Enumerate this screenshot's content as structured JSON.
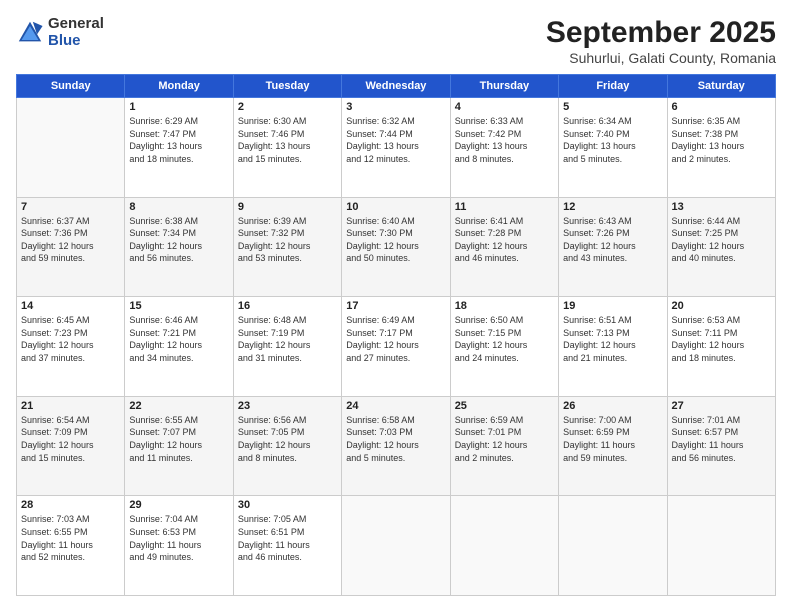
{
  "logo": {
    "general": "General",
    "blue": "Blue"
  },
  "title": "September 2025",
  "subtitle": "Suhurlui, Galati County, Romania",
  "days_header": [
    "Sunday",
    "Monday",
    "Tuesday",
    "Wednesday",
    "Thursday",
    "Friday",
    "Saturday"
  ],
  "weeks": [
    [
      {
        "num": "",
        "info": ""
      },
      {
        "num": "1",
        "info": "Sunrise: 6:29 AM\nSunset: 7:47 PM\nDaylight: 13 hours\nand 18 minutes."
      },
      {
        "num": "2",
        "info": "Sunrise: 6:30 AM\nSunset: 7:46 PM\nDaylight: 13 hours\nand 15 minutes."
      },
      {
        "num": "3",
        "info": "Sunrise: 6:32 AM\nSunset: 7:44 PM\nDaylight: 13 hours\nand 12 minutes."
      },
      {
        "num": "4",
        "info": "Sunrise: 6:33 AM\nSunset: 7:42 PM\nDaylight: 13 hours\nand 8 minutes."
      },
      {
        "num": "5",
        "info": "Sunrise: 6:34 AM\nSunset: 7:40 PM\nDaylight: 13 hours\nand 5 minutes."
      },
      {
        "num": "6",
        "info": "Sunrise: 6:35 AM\nSunset: 7:38 PM\nDaylight: 13 hours\nand 2 minutes."
      }
    ],
    [
      {
        "num": "7",
        "info": "Sunrise: 6:37 AM\nSunset: 7:36 PM\nDaylight: 12 hours\nand 59 minutes."
      },
      {
        "num": "8",
        "info": "Sunrise: 6:38 AM\nSunset: 7:34 PM\nDaylight: 12 hours\nand 56 minutes."
      },
      {
        "num": "9",
        "info": "Sunrise: 6:39 AM\nSunset: 7:32 PM\nDaylight: 12 hours\nand 53 minutes."
      },
      {
        "num": "10",
        "info": "Sunrise: 6:40 AM\nSunset: 7:30 PM\nDaylight: 12 hours\nand 50 minutes."
      },
      {
        "num": "11",
        "info": "Sunrise: 6:41 AM\nSunset: 7:28 PM\nDaylight: 12 hours\nand 46 minutes."
      },
      {
        "num": "12",
        "info": "Sunrise: 6:43 AM\nSunset: 7:26 PM\nDaylight: 12 hours\nand 43 minutes."
      },
      {
        "num": "13",
        "info": "Sunrise: 6:44 AM\nSunset: 7:25 PM\nDaylight: 12 hours\nand 40 minutes."
      }
    ],
    [
      {
        "num": "14",
        "info": "Sunrise: 6:45 AM\nSunset: 7:23 PM\nDaylight: 12 hours\nand 37 minutes."
      },
      {
        "num": "15",
        "info": "Sunrise: 6:46 AM\nSunset: 7:21 PM\nDaylight: 12 hours\nand 34 minutes."
      },
      {
        "num": "16",
        "info": "Sunrise: 6:48 AM\nSunset: 7:19 PM\nDaylight: 12 hours\nand 31 minutes."
      },
      {
        "num": "17",
        "info": "Sunrise: 6:49 AM\nSunset: 7:17 PM\nDaylight: 12 hours\nand 27 minutes."
      },
      {
        "num": "18",
        "info": "Sunrise: 6:50 AM\nSunset: 7:15 PM\nDaylight: 12 hours\nand 24 minutes."
      },
      {
        "num": "19",
        "info": "Sunrise: 6:51 AM\nSunset: 7:13 PM\nDaylight: 12 hours\nand 21 minutes."
      },
      {
        "num": "20",
        "info": "Sunrise: 6:53 AM\nSunset: 7:11 PM\nDaylight: 12 hours\nand 18 minutes."
      }
    ],
    [
      {
        "num": "21",
        "info": "Sunrise: 6:54 AM\nSunset: 7:09 PM\nDaylight: 12 hours\nand 15 minutes."
      },
      {
        "num": "22",
        "info": "Sunrise: 6:55 AM\nSunset: 7:07 PM\nDaylight: 12 hours\nand 11 minutes."
      },
      {
        "num": "23",
        "info": "Sunrise: 6:56 AM\nSunset: 7:05 PM\nDaylight: 12 hours\nand 8 minutes."
      },
      {
        "num": "24",
        "info": "Sunrise: 6:58 AM\nSunset: 7:03 PM\nDaylight: 12 hours\nand 5 minutes."
      },
      {
        "num": "25",
        "info": "Sunrise: 6:59 AM\nSunset: 7:01 PM\nDaylight: 12 hours\nand 2 minutes."
      },
      {
        "num": "26",
        "info": "Sunrise: 7:00 AM\nSunset: 6:59 PM\nDaylight: 11 hours\nand 59 minutes."
      },
      {
        "num": "27",
        "info": "Sunrise: 7:01 AM\nSunset: 6:57 PM\nDaylight: 11 hours\nand 56 minutes."
      }
    ],
    [
      {
        "num": "28",
        "info": "Sunrise: 7:03 AM\nSunset: 6:55 PM\nDaylight: 11 hours\nand 52 minutes."
      },
      {
        "num": "29",
        "info": "Sunrise: 7:04 AM\nSunset: 6:53 PM\nDaylight: 11 hours\nand 49 minutes."
      },
      {
        "num": "30",
        "info": "Sunrise: 7:05 AM\nSunset: 6:51 PM\nDaylight: 11 hours\nand 46 minutes."
      },
      {
        "num": "",
        "info": ""
      },
      {
        "num": "",
        "info": ""
      },
      {
        "num": "",
        "info": ""
      },
      {
        "num": "",
        "info": ""
      }
    ]
  ]
}
